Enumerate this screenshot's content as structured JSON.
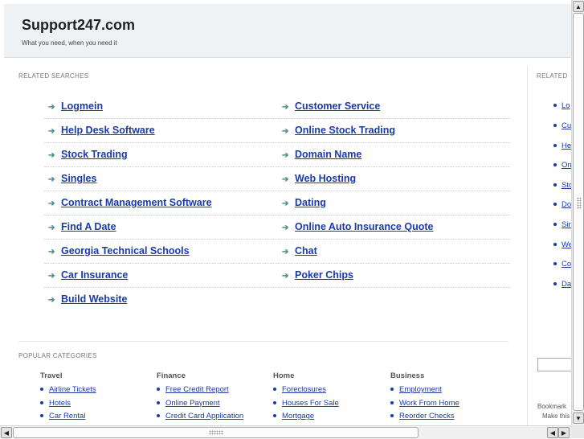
{
  "header": {
    "title": "Support247.com",
    "tagline": "What you need, when you need it"
  },
  "related": {
    "label": "RELATED SEARCHES",
    "left": [
      "Logmein",
      "Help Desk Software",
      "Stock Trading",
      "Singles",
      "Contract Management Software",
      "Find A Date",
      "Georgia Technical Schools",
      "Car Insurance",
      "Build Website"
    ],
    "right": [
      "Customer Service",
      "Online Stock Trading",
      "Domain Name",
      "Web Hosting",
      "Dating",
      "Online Auto Insurance Quote",
      "Chat",
      "Poker Chips"
    ]
  },
  "popular": {
    "label": "POPULAR CATEGORIES",
    "columns": [
      {
        "title": "Travel",
        "links": [
          "Airline Tickets",
          "Hotels",
          "Car Rental"
        ]
      },
      {
        "title": "Finance",
        "links": [
          "Free Credit Report",
          "Online Payment",
          "Credit Card Application"
        ]
      },
      {
        "title": "Home",
        "links": [
          "Foreclosures",
          "Houses For Sale",
          "Mortgage"
        ]
      },
      {
        "title": "Business",
        "links": [
          "Employment",
          "Work From Home",
          "Reorder Checks"
        ]
      }
    ]
  },
  "sidebar": {
    "label": "RELATED",
    "items": [
      "Lo",
      "Cu",
      "He",
      "On",
      "Sto",
      "Do",
      "Sin",
      "We",
      "Co",
      "Da"
    ],
    "bookmark": "Bookmark",
    "makethis": "Make this"
  },
  "icons": {
    "arrow": "arrow-right-icon",
    "scroll_up": "scroll-up-icon",
    "scroll_down": "scroll-down-icon",
    "scroll_left": "scroll-left-icon",
    "scroll_right": "scroll-right-icon"
  },
  "colors": {
    "link": "#1a3aa8",
    "header_bg": "#eef2f4",
    "arrow": "#4a8f8f"
  }
}
